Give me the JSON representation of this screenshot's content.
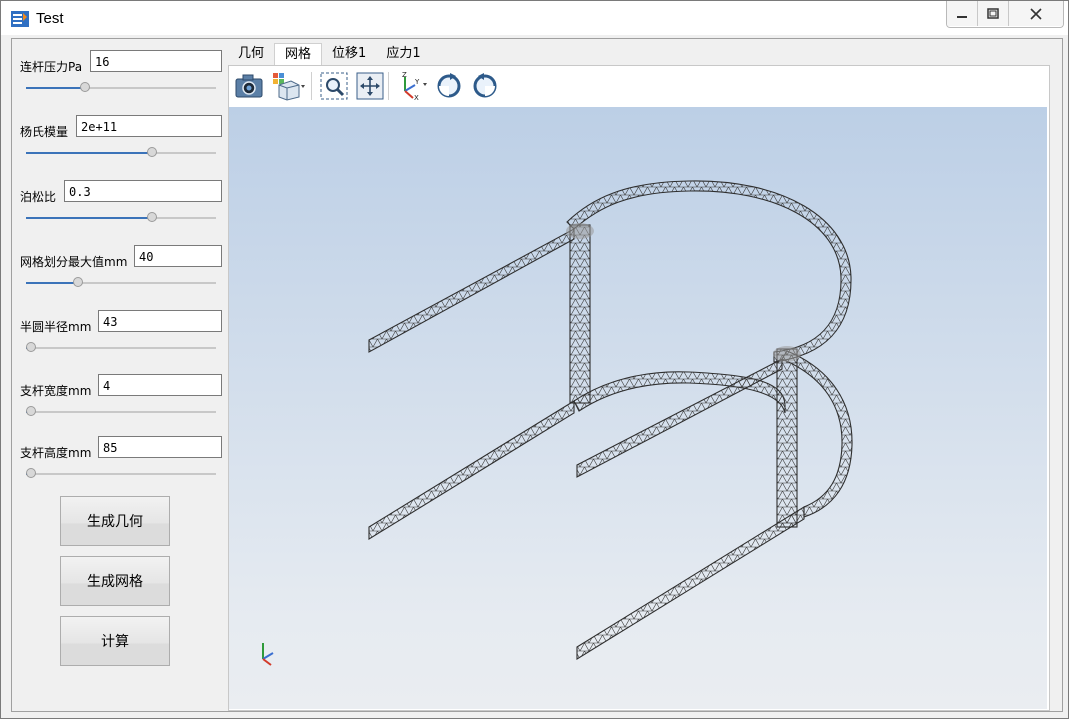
{
  "window": {
    "title": "Test"
  },
  "params": [
    {
      "label": "连杆压力Pa",
      "value": "16",
      "slider": 0.3
    },
    {
      "label": "杨氏模量",
      "value": "2e+11",
      "slider": 0.67
    },
    {
      "label": "泊松比",
      "value": "0.3",
      "slider": 0.67
    },
    {
      "label": "网格划分最大值mm",
      "value": "40",
      "slider": 0.26
    },
    {
      "label": "半圆半径mm",
      "value": "43",
      "slider": 0.0
    },
    {
      "label": "支杆宽度mm",
      "value": "4",
      "slider": 0.0
    },
    {
      "label": "支杆高度mm",
      "value": "85",
      "slider": 0.0
    }
  ],
  "buttons": {
    "geometry": "生成几何",
    "mesh": "生成网格",
    "compute": "计算"
  },
  "tabs": [
    "几何",
    "网格",
    "位移1",
    "应力1"
  ],
  "active_tab": "网格",
  "toolbar_icons": [
    "camera-icon",
    "view-cube-icon",
    "zoom-box-icon",
    "fit-all-icon",
    "axes-icon",
    "rotate-cw-icon",
    "rotate-ccw-icon"
  ],
  "colors": {
    "accent": "#3b73b9",
    "viewport_top": "#bccfe6",
    "viewport_bottom": "#eaedf1"
  }
}
